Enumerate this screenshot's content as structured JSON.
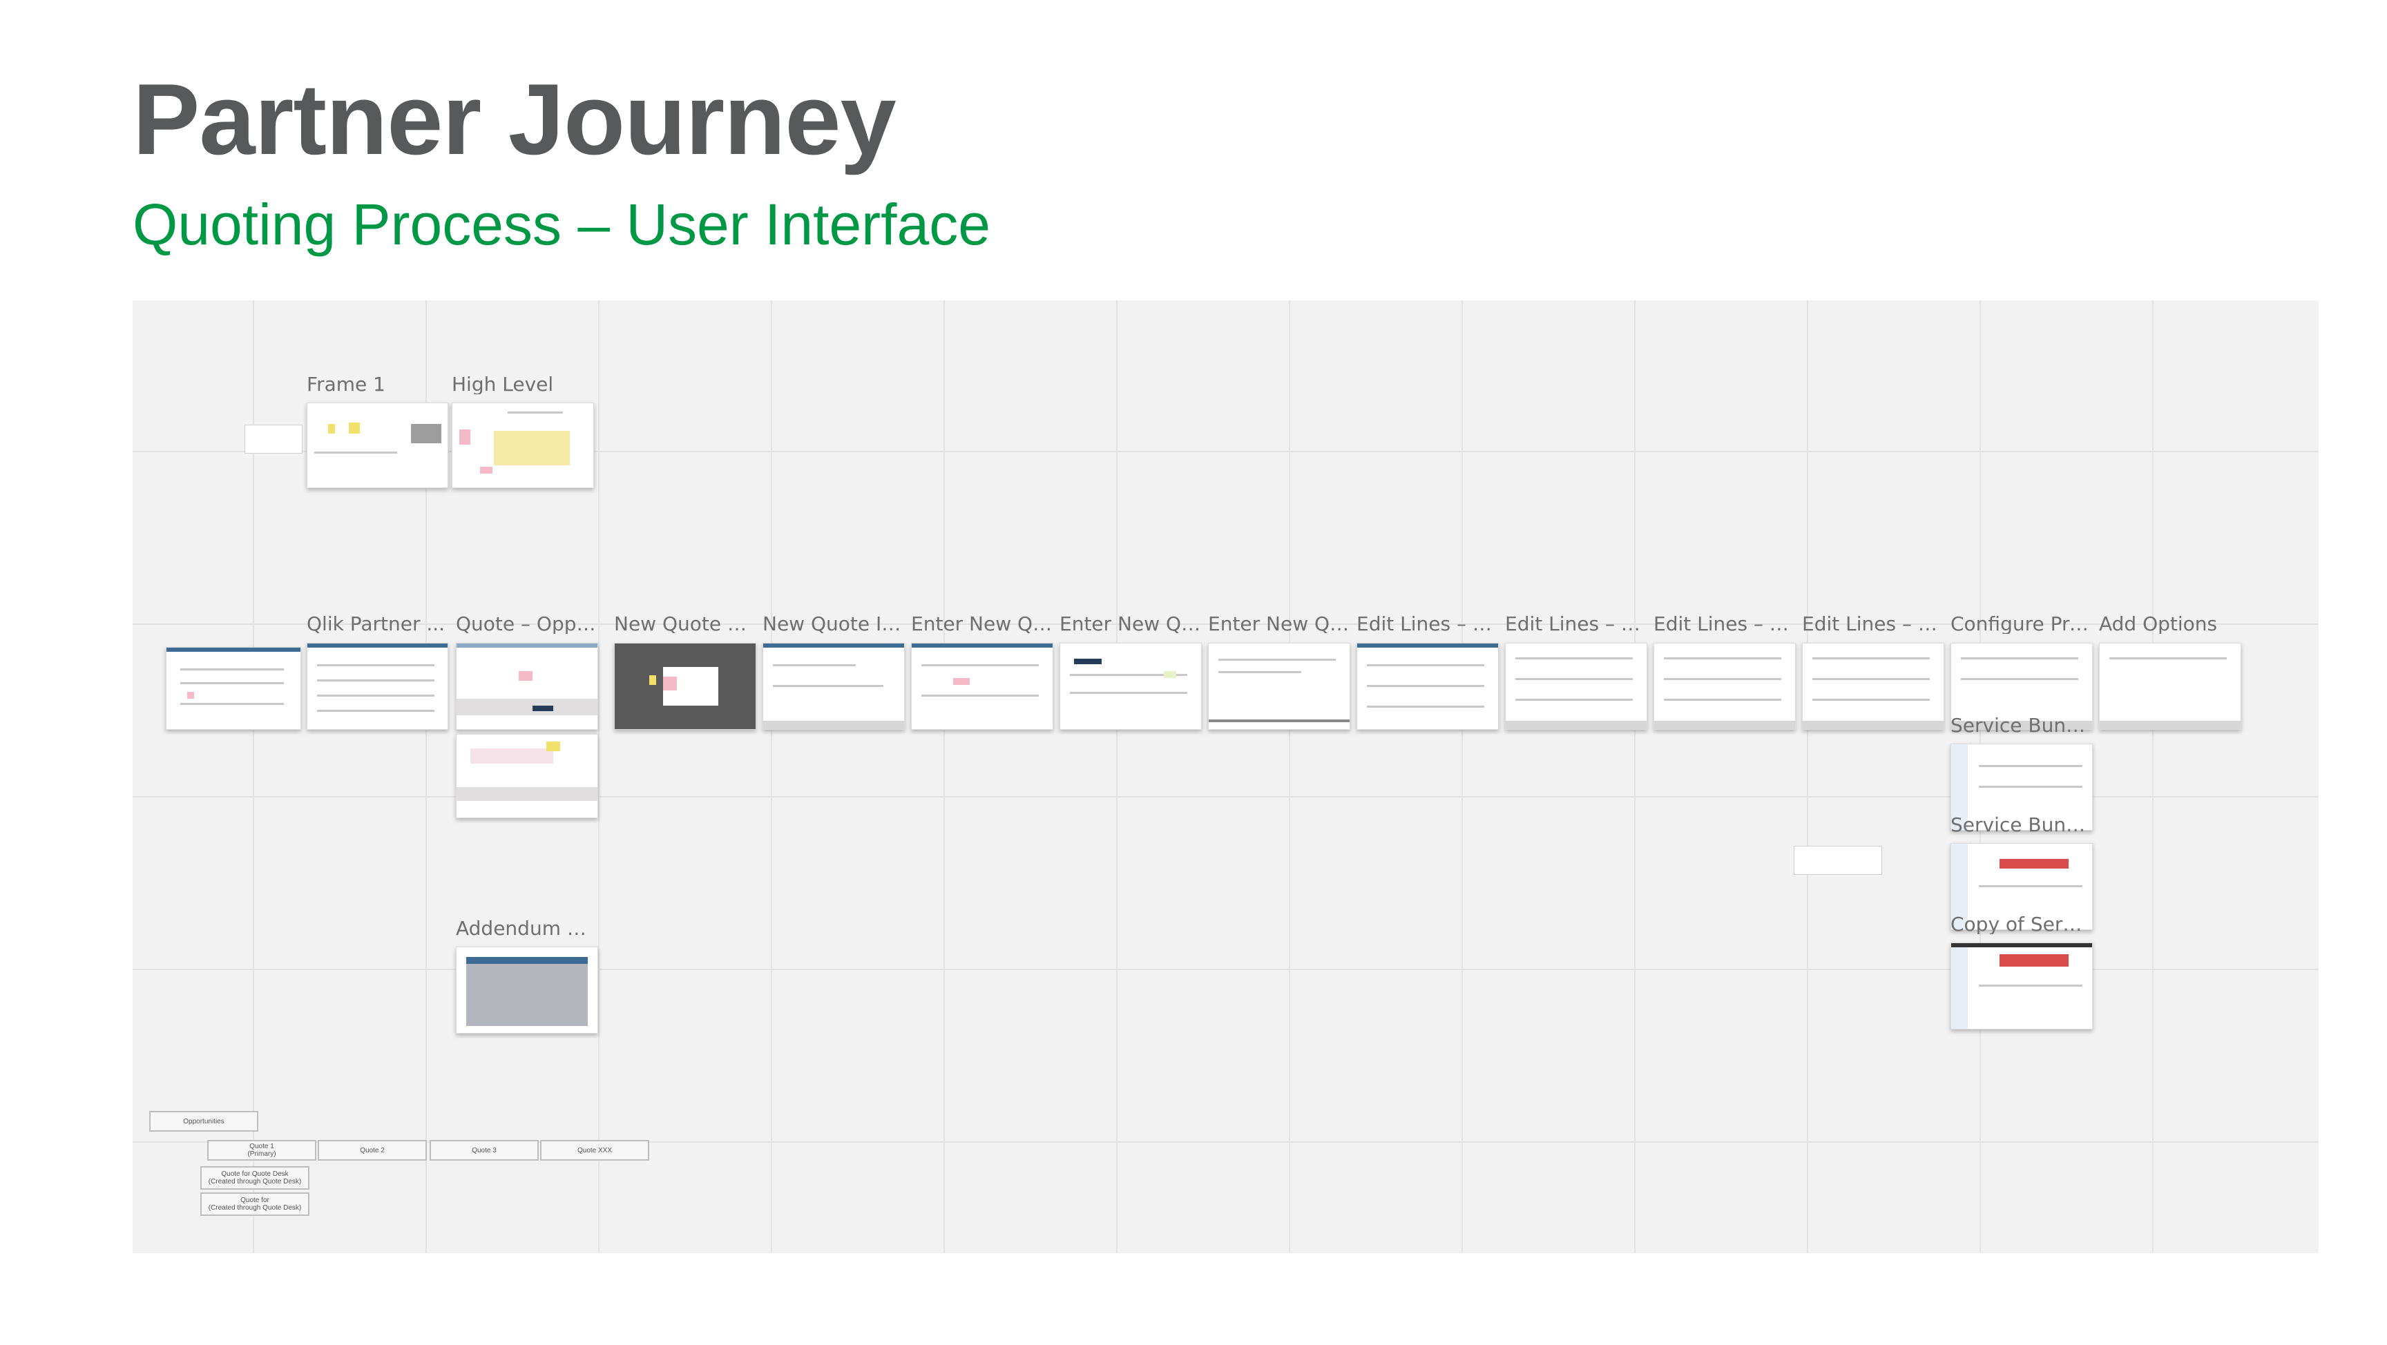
{
  "header": {
    "title": "Partner Journey",
    "subtitle": "Quoting Process – User Interface"
  },
  "colors": {
    "title": "#58595b",
    "subtitle": "#009845",
    "canvas": "#f2f2f2"
  },
  "frames": {
    "frame1": "Frame 1",
    "high_level": "High Level",
    "qlik_partner": "Qlik Partner ...",
    "quote_oppo": "Quote – Oppo...",
    "new_quote_dash": "New Quote – ...",
    "new_quote_in": "New Quote In...",
    "enter_new_qu_1": "Enter New Qu...",
    "enter_new_qu_2": "Enter New Qu...",
    "enter_new_qu_3": "Enter New Qu...",
    "edit_lines_1": "Edit Lines – by...",
    "edit_lines_2": "Edit Lines – by...",
    "edit_lines_3": "Edit Lines – by...",
    "edit_lines_4": "Edit Lines – by...",
    "configure_pro": "Configure Pro...",
    "add_options": "Add Options",
    "service_bundl_1": "Service Bundl...",
    "service_bundl_2": "Service Bundl...",
    "copy_of_servic": "Copy of Servic...",
    "addendum_q": "Addendum Q..."
  },
  "diagram": {
    "opportunities": "Opportunities",
    "quote1": "Quote 1",
    "quote1_sub": "(Primary)",
    "quote2": "Quote 2",
    "quote3": "Quote 3",
    "quote_n": "Quote XXX",
    "child1_line1": "Quote for Quote Desk",
    "child1_line2": "(Created through Quote Desk)",
    "child2_line1": "Quote for",
    "child2_line2": "(Created through Quote Desk)"
  }
}
